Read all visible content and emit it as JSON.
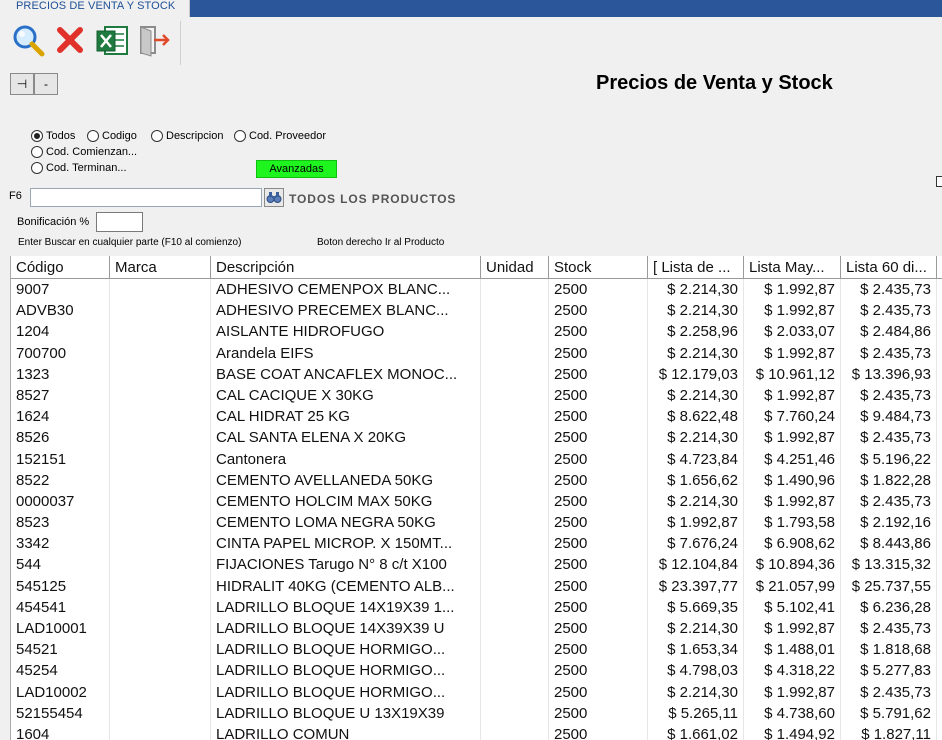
{
  "window": {
    "tab_label": "PRECIOS DE VENTA Y STOCK"
  },
  "toolbar": {
    "search_icon": "search-icon",
    "close_icon": "close-icon",
    "excel_icon": "excel-icon",
    "exit_icon": "exit-icon"
  },
  "panel": {
    "pin_label": "⊣",
    "minus_label": "-"
  },
  "title": "Precios de Venta y Stock",
  "filters": {
    "options": [
      "Todos",
      "Codigo",
      "Descripcion",
      "Cod. Proveedor",
      "Cod. Comienzan...",
      "Cod. Terminan..."
    ],
    "selected": "Todos",
    "advanced_label": "Avanzadas"
  },
  "search": {
    "f6_label": "F6",
    "value": "",
    "all_products_label": "TODOS LOS PRODUCTOS"
  },
  "bonificacion": {
    "label": "Bonificación %",
    "value": ""
  },
  "hints": {
    "search_hint": "Enter Buscar en cualquier parte (F10 al comienzo)",
    "right_click_hint": "Boton derecho Ir al Producto"
  },
  "colors": {
    "tab_bar": "#2b579a",
    "advanced_button": "#1ef51e"
  },
  "grid": {
    "columns": [
      "Código",
      "Marca",
      "Descripción",
      "Unidad",
      "Stock",
      "[ Lista de ...",
      "Lista May...",
      "Lista 60 di..."
    ],
    "rows": [
      [
        "9007",
        "",
        "ADHESIVO CEMENPOX BLANC...",
        "",
        "2500",
        "$ 2.214,30",
        "$ 1.992,87",
        "$ 2.435,73"
      ],
      [
        "ADVB30",
        "",
        "ADHESIVO PRECEMEX BLANC...",
        "",
        "2500",
        "$ 2.214,30",
        "$ 1.992,87",
        "$ 2.435,73"
      ],
      [
        "1204",
        "",
        "AISLANTE HIDROFUGO",
        "",
        "2500",
        "$ 2.258,96",
        "$ 2.033,07",
        "$ 2.484,86"
      ],
      [
        "700700",
        "",
        "Arandela EIFS",
        "",
        "2500",
        "$ 2.214,30",
        "$ 1.992,87",
        "$ 2.435,73"
      ],
      [
        "1323",
        "",
        "BASE COAT ANCAFLEX MONOC...",
        "",
        "2500",
        "$ 12.179,03",
        "$ 10.961,12",
        "$ 13.396,93"
      ],
      [
        "8527",
        "",
        "CAL CACIQUE X 30KG",
        "",
        "2500",
        "$ 2.214,30",
        "$ 1.992,87",
        "$ 2.435,73"
      ],
      [
        "1624",
        "",
        "CAL HIDRAT 25 KG",
        "",
        "2500",
        "$ 8.622,48",
        "$ 7.760,24",
        "$ 9.484,73"
      ],
      [
        "8526",
        "",
        "CAL SANTA ELENA X 20KG",
        "",
        "2500",
        "$ 2.214,30",
        "$ 1.992,87",
        "$ 2.435,73"
      ],
      [
        "152151",
        "",
        "Cantonera",
        "",
        "2500",
        "$ 4.723,84",
        "$ 4.251,46",
        "$ 5.196,22"
      ],
      [
        "8522",
        "",
        "CEMENTO AVELLANEDA 50KG",
        "",
        "2500",
        "$ 1.656,62",
        "$ 1.490,96",
        "$ 1.822,28"
      ],
      [
        "0000037",
        "",
        "CEMENTO HOLCIM MAX 50KG",
        "",
        "2500",
        "$ 2.214,30",
        "$ 1.992,87",
        "$ 2.435,73"
      ],
      [
        "8523",
        "",
        "CEMENTO LOMA NEGRA 50KG",
        "",
        "2500",
        "$ 1.992,87",
        "$ 1.793,58",
        "$ 2.192,16"
      ],
      [
        "3342",
        "",
        "CINTA PAPEL MICROP. X 150MT...",
        "",
        "2500",
        "$ 7.676,24",
        "$ 6.908,62",
        "$ 8.443,86"
      ],
      [
        "544",
        "",
        "FIJACIONES Tarugo  N° 8 c/t X100",
        "",
        "2500",
        "$ 12.104,84",
        "$ 10.894,36",
        "$ 13.315,32"
      ],
      [
        "545125",
        "",
        "HIDRALIT 40KG (CEMENTO ALB...",
        "",
        "2500",
        "$ 23.397,77",
        "$ 21.057,99",
        "$ 25.737,55"
      ],
      [
        "454541",
        "",
        "LADRILLO BLOQUE 14X19X39 1...",
        "",
        "2500",
        "$ 5.669,35",
        "$ 5.102,41",
        "$ 6.236,28"
      ],
      [
        "LAD10001",
        "",
        "LADRILLO BLOQUE 14X39X39 U",
        "",
        "2500",
        "$ 2.214,30",
        "$ 1.992,87",
        "$ 2.435,73"
      ],
      [
        "54521",
        "",
        "LADRILLO BLOQUE HORMIGO...",
        "",
        "2500",
        "$ 1.653,34",
        "$ 1.488,01",
        "$ 1.818,68"
      ],
      [
        "45254",
        "",
        "LADRILLO BLOQUE HORMIGO...",
        "",
        "2500",
        "$ 4.798,03",
        "$ 4.318,22",
        "$ 5.277,83"
      ],
      [
        "LAD10002",
        "",
        "LADRILLO BLOQUE HORMIGO...",
        "",
        "2500",
        "$ 2.214,30",
        "$ 1.992,87",
        "$ 2.435,73"
      ],
      [
        "52155454",
        "",
        "LADRILLO BLOQUE U 13X19X39",
        "",
        "2500",
        "$ 5.265,11",
        "$ 4.738,60",
        "$ 5.791,62"
      ],
      [
        "1604",
        "",
        "LADRILLO COMUN",
        "",
        "2500",
        "$ 1.661,02",
        "$ 1.494,92",
        "$ 1.827,11"
      ]
    ]
  }
}
